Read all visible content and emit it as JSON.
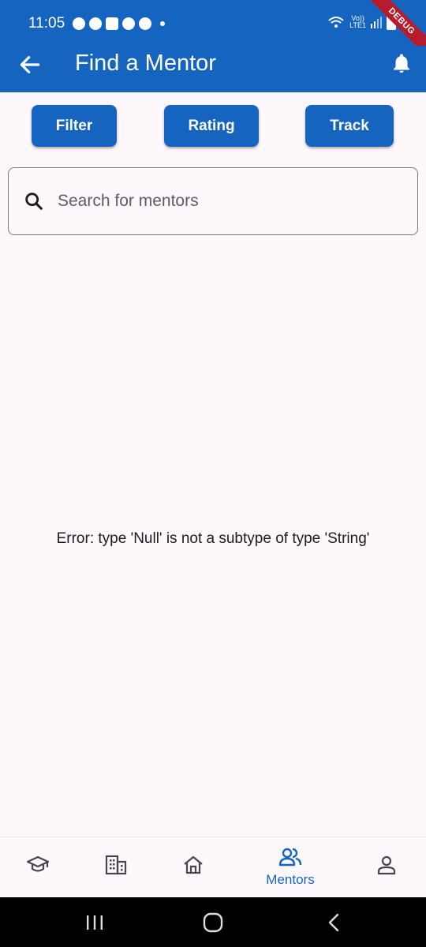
{
  "status_bar": {
    "time": "11:05",
    "volte": "Vo))",
    "lte": "LTE1",
    "debug": "DEBUG"
  },
  "app_bar": {
    "title": "Find a Mentor"
  },
  "actions": {
    "filter": "Filter",
    "rating": "Rating",
    "track": "Track"
  },
  "search": {
    "placeholder": "Search for mentors",
    "value": ""
  },
  "error": "Error: type 'Null' is not a subtype of type 'String'",
  "bottom_nav": {
    "items": [
      {
        "icon": "school-icon",
        "label": ""
      },
      {
        "icon": "companies-icon",
        "label": ""
      },
      {
        "icon": "home-icon",
        "label": ""
      },
      {
        "icon": "mentors-icon",
        "label": "Mentors",
        "active": true
      },
      {
        "icon": "profile-icon",
        "label": ""
      }
    ]
  },
  "colors": {
    "primary": "#1565c0",
    "background": "#fef7fc",
    "debug": "#b71c2c"
  }
}
